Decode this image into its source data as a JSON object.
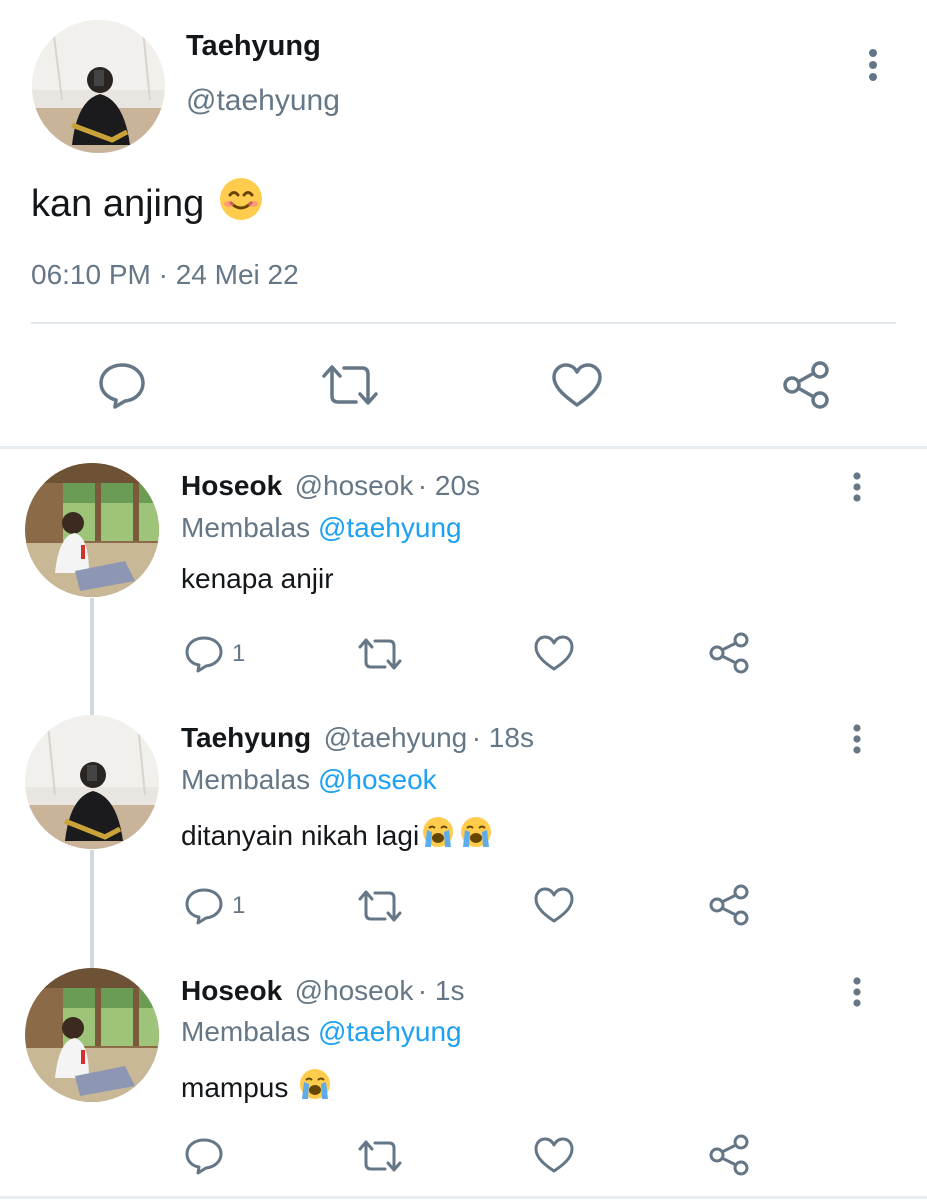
{
  "main_tweet": {
    "name": "Taehyung",
    "handle": "@taehyung",
    "text": "kan anjing",
    "timestamp": "06:10 PM · 24 Mei 22",
    "emoji": "smiling-face-emoji",
    "actions": [
      "reply-icon",
      "retweet-icon",
      "like-icon",
      "share-icon"
    ]
  },
  "replies": [
    {
      "name": "Hoseok",
      "handle": "@hoseok",
      "time": "· 20s",
      "reply_prefix": "Membalas",
      "reply_to": "@taehyung",
      "text": "kenapa anjir",
      "reply_count": "1"
    },
    {
      "name": "Taehyung",
      "handle": "@taehyung",
      "time": "· 18s",
      "reply_prefix": "Membalas",
      "reply_to": "@hoseok",
      "text": "ditanyain nikah lagi",
      "reply_count": "1"
    },
    {
      "name": "Hoseok",
      "handle": "@hoseok",
      "time": "· 1s",
      "reply_prefix": "Membalas",
      "reply_to": "@taehyung",
      "text": "mampus",
      "reply_count": ""
    }
  ],
  "colors": {
    "primary_text": "#14171a",
    "secondary_text": "#657786",
    "mention": "#1da1f2",
    "divider": "#e1e8ed"
  }
}
